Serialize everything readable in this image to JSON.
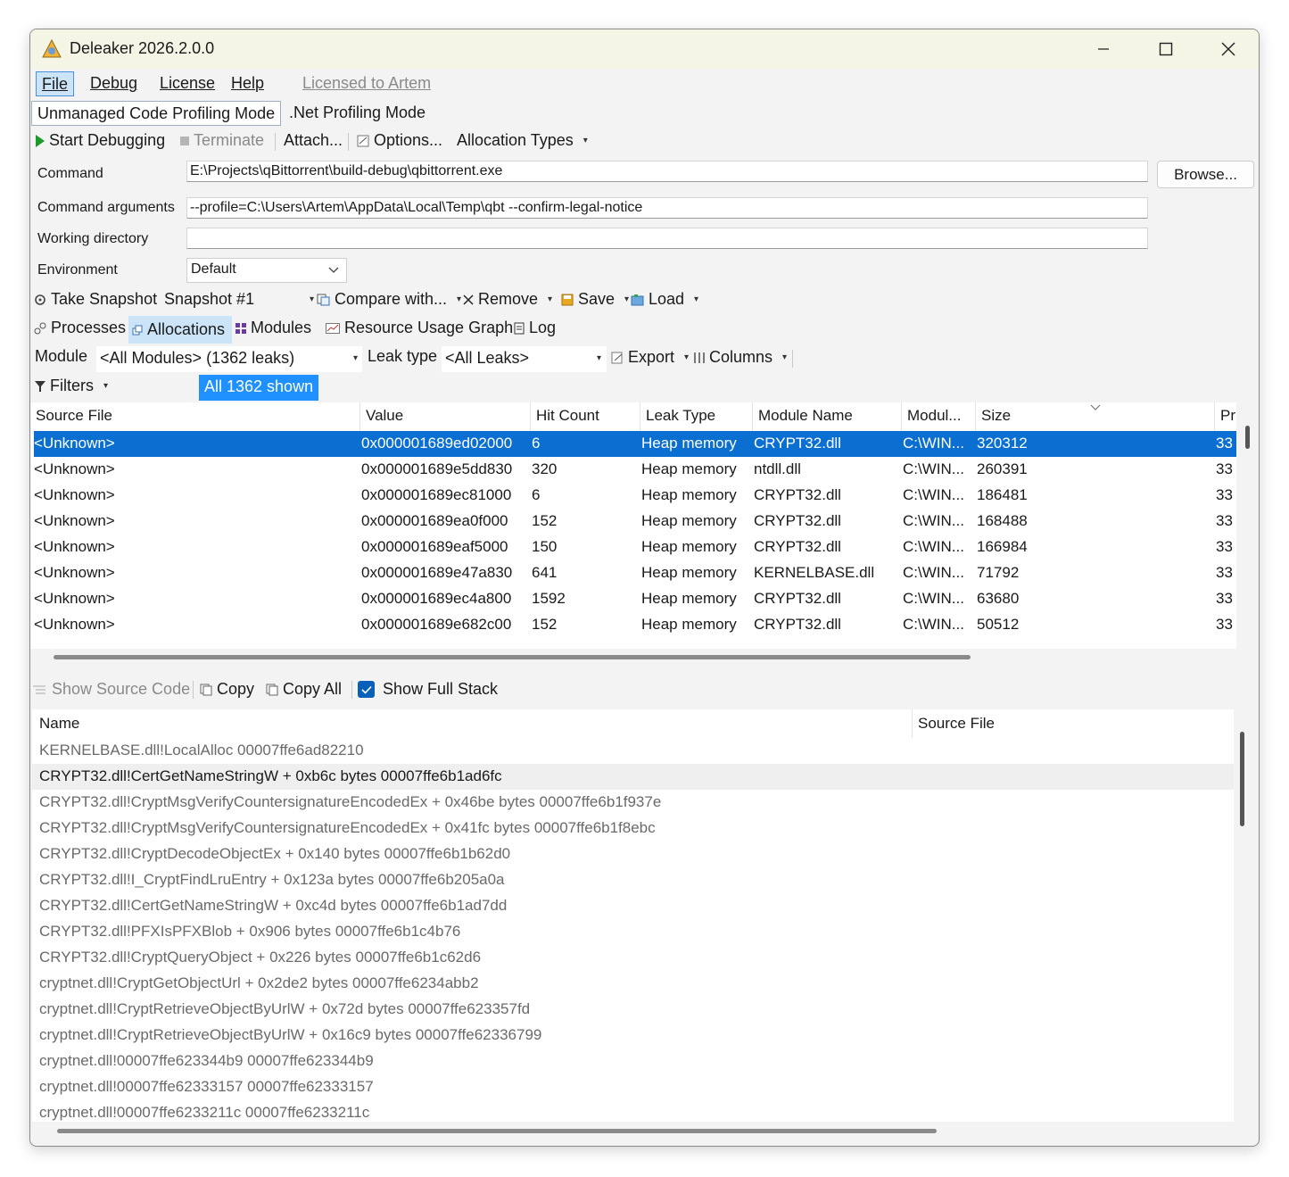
{
  "window": {
    "title": "Deleaker 2026.2.0.0"
  },
  "menu": {
    "items": [
      "File",
      "Debug",
      "License",
      "Help"
    ],
    "licensed": "Licensed to Artem"
  },
  "modes": [
    "Unmanaged Code Profiling Mode",
    ".Net Profiling Mode"
  ],
  "debug_toolbar": {
    "start": "Start Debugging",
    "terminate": "Terminate",
    "attach": "Attach...",
    "options": "Options...",
    "allocation_types": "Allocation Types"
  },
  "form": {
    "command_label": "Command",
    "command_value": "E:\\Projects\\qBittorrent\\build-debug\\qbittorrent.exe",
    "browse": "Browse...",
    "args_label": "Command arguments",
    "args_value": "--profile=C:\\Users\\Artem\\AppData\\Local\\Temp\\qbt --confirm-legal-notice",
    "workdir_label": "Working directory",
    "workdir_value": "",
    "env_label": "Environment",
    "env_value": "Default"
  },
  "snapshot_toolbar": {
    "take": "Take Snapshot",
    "snapshot": "Snapshot #1",
    "compare": "Compare with...",
    "remove": "Remove",
    "save": "Save",
    "load": "Load"
  },
  "view_tabs": [
    "Processes",
    "Allocations",
    "Modules",
    "Resource Usage Graph",
    "Log"
  ],
  "filter_bar": {
    "module_label": "Module",
    "module_value": "<All Modules> (1362 leaks)",
    "leak_type_label": "Leak type",
    "leak_type_value": "<All Leaks>",
    "export": "Export",
    "columns": "Columns",
    "filters": "Filters",
    "shown": "All 1362 shown"
  },
  "grid": {
    "columns": [
      "Source File",
      "Value",
      "Hit Count",
      "Leak Type",
      "Module Name",
      "Modul...",
      "Size",
      "Pr"
    ],
    "rows": [
      [
        "<Unknown>",
        "0x000001689ed02000",
        "6",
        "Heap memory",
        "CRYPT32.dll",
        "C:\\WIN...",
        "320312",
        "33"
      ],
      [
        "<Unknown>",
        "0x000001689e5dd830",
        "320",
        "Heap memory",
        "ntdll.dll",
        "C:\\WIN...",
        "260391",
        "33"
      ],
      [
        "<Unknown>",
        "0x000001689ec81000",
        "6",
        "Heap memory",
        "CRYPT32.dll",
        "C:\\WIN...",
        "186481",
        "33"
      ],
      [
        "<Unknown>",
        "0x000001689ea0f000",
        "152",
        "Heap memory",
        "CRYPT32.dll",
        "C:\\WIN...",
        "168488",
        "33"
      ],
      [
        "<Unknown>",
        "0x000001689eaf5000",
        "150",
        "Heap memory",
        "CRYPT32.dll",
        "C:\\WIN...",
        "166984",
        "33"
      ],
      [
        "<Unknown>",
        "0x000001689e47a830",
        "641",
        "Heap memory",
        "KERNELBASE.dll",
        "C:\\WIN...",
        "71792",
        "33"
      ],
      [
        "<Unknown>",
        "0x000001689ec4a800",
        "1592",
        "Heap memory",
        "CRYPT32.dll",
        "C:\\WIN...",
        "63680",
        "33"
      ],
      [
        "<Unknown>",
        "0x000001689e682c00",
        "152",
        "Heap memory",
        "CRYPT32.dll",
        "C:\\WIN...",
        "50512",
        "33"
      ]
    ]
  },
  "stack_toolbar": {
    "show_source": "Show Source Code",
    "copy": "Copy",
    "copy_all": "Copy All",
    "show_full_stack": "Show Full Stack"
  },
  "stack": {
    "columns": [
      "Name",
      "Source File"
    ],
    "frames": [
      "KERNELBASE.dll!LocalAlloc 00007ffe6ad82210",
      "CRYPT32.dll!CertGetNameStringW + 0xb6c bytes 00007ffe6b1ad6fc",
      "CRYPT32.dll!CryptMsgVerifyCountersignatureEncodedEx + 0x46be bytes 00007ffe6b1f937e",
      "CRYPT32.dll!CryptMsgVerifyCountersignatureEncodedEx + 0x41fc bytes 00007ffe6b1f8ebc",
      "CRYPT32.dll!CryptDecodeObjectEx + 0x140 bytes 00007ffe6b1b62d0",
      "CRYPT32.dll!I_CryptFindLruEntry + 0x123a bytes 00007ffe6b205a0a",
      "CRYPT32.dll!CertGetNameStringW + 0xc4d bytes 00007ffe6b1ad7dd",
      "CRYPT32.dll!PFXIsPFXBlob + 0x906 bytes 00007ffe6b1c4b76",
      "CRYPT32.dll!CryptQueryObject + 0x226 bytes 00007ffe6b1c62d6",
      "cryptnet.dll!CryptGetObjectUrl + 0x2de2 bytes 00007ffe6234abb2",
      "cryptnet.dll!CryptRetrieveObjectByUrlW + 0x72d bytes 00007ffe623357fd",
      "cryptnet.dll!CryptRetrieveObjectByUrlW + 0x16c9 bytes 00007ffe62336799",
      "cryptnet.dll!00007ffe623344b9 00007ffe623344b9",
      "cryptnet.dll!00007ffe62333157 00007ffe62333157",
      "cryptnet.dll!00007ffe6233211c 00007ffe6233211c"
    ]
  },
  "colors": {
    "selection": "#0a6fd0",
    "accent": "#1e90ff",
    "tab_active": "#cce4f7"
  },
  "icons": [
    "app-icon",
    "play-icon",
    "stop-icon",
    "attach-icon",
    "options-icon",
    "snapshot-icon",
    "compare-icon",
    "remove-icon",
    "save-icon",
    "load-icon",
    "processes-icon",
    "allocations-icon",
    "modules-icon",
    "graph-icon",
    "log-icon",
    "export-icon",
    "columns-icon",
    "filter-icon",
    "copy-icon",
    "check-icon"
  ]
}
